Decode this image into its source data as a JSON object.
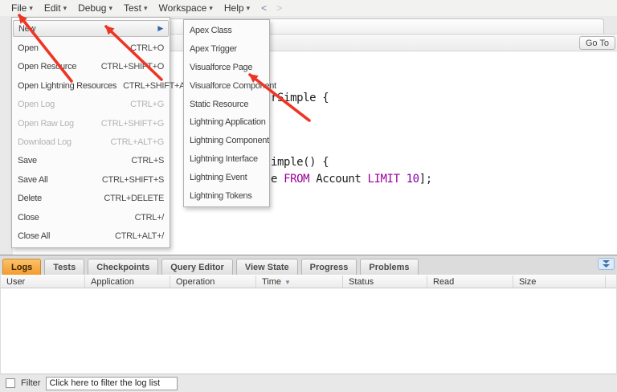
{
  "menu_bar": {
    "items": [
      {
        "label": "File"
      },
      {
        "label": "Edit"
      },
      {
        "label": "Debug"
      },
      {
        "label": "Test"
      },
      {
        "label": "Workspace"
      },
      {
        "label": "Help"
      }
    ],
    "back_arrow": "<",
    "forward_arrow": ">"
  },
  "icons": {
    "caret_down": "▾",
    "submenu_arrow": "▶",
    "sort_down": "▼"
  },
  "file_menu": {
    "items": [
      {
        "label": "New",
        "shortcut": ""
      },
      {
        "label": "Open",
        "shortcut": "CTRL+O"
      },
      {
        "label": "Open Resource",
        "shortcut": "CTRL+SHIFT+O"
      },
      {
        "label": "Open Lightning Resources",
        "shortcut": "CTRL+SHIFT+A"
      },
      {
        "label": "Open Log",
        "shortcut": "CTRL+G",
        "disabled": true
      },
      {
        "label": "Open Raw Log",
        "shortcut": "CTRL+SHIFT+G",
        "disabled": true
      },
      {
        "label": "Download Log",
        "shortcut": "CTRL+ALT+G",
        "disabled": true
      },
      {
        "label": "Save",
        "shortcut": "CTRL+S"
      },
      {
        "label": "Save All",
        "shortcut": "CTRL+SHIFT+S"
      },
      {
        "label": "Delete",
        "shortcut": "CTRL+DELETE"
      },
      {
        "label": "Close",
        "shortcut": "CTRL+/"
      },
      {
        "label": "Close All",
        "shortcut": "CTRL+ALT+/"
      }
    ]
  },
  "new_submenu": {
    "items": [
      {
        "label": "Apex Class"
      },
      {
        "label": "Apex Trigger"
      },
      {
        "label": "Visualforce Page"
      },
      {
        "label": "Visualforce Component"
      },
      {
        "label": "Static Resource"
      },
      {
        "label": "Lightning Application"
      },
      {
        "label": "Lightning Component"
      },
      {
        "label": "Lightning Interface"
      },
      {
        "label": "Lightning Event"
      },
      {
        "label": "Lightning Tokens"
      }
    ]
  },
  "editor": {
    "go_to_label": "Go To",
    "code_line1": "rSimple {",
    "code_line2": "imple() {",
    "code_line3": {
      "t1": "e ",
      "t2": "FROM",
      "t3": " Account ",
      "t4": "LIMIT",
      "t5": " ",
      "t6": "10",
      "t7": "];"
    }
  },
  "bottom_panel": {
    "tabs": [
      {
        "label": "Logs",
        "active": true
      },
      {
        "label": "Tests"
      },
      {
        "label": "Checkpoints"
      },
      {
        "label": "Query Editor"
      },
      {
        "label": "View State"
      },
      {
        "label": "Progress"
      },
      {
        "label": "Problems"
      }
    ],
    "columns": [
      {
        "label": "User"
      },
      {
        "label": "Application"
      },
      {
        "label": "Operation"
      },
      {
        "label": "Time",
        "sorted": "desc"
      },
      {
        "label": "Status"
      },
      {
        "label": "Read"
      },
      {
        "label": "Size"
      }
    ],
    "rows": [],
    "filter": {
      "checkbox_label": "Filter",
      "input_value": "Click here to filter the log list"
    }
  },
  "colors": {
    "active_tab_orange": "#f49b2e",
    "annotation_arrow_red": "#ee3524",
    "code_keyword_purple": "#990099",
    "code_number_purple": "#8000a8",
    "submenu_arrow_blue": "#2a66ab",
    "collapse_button_blue": "#dceafa"
  }
}
